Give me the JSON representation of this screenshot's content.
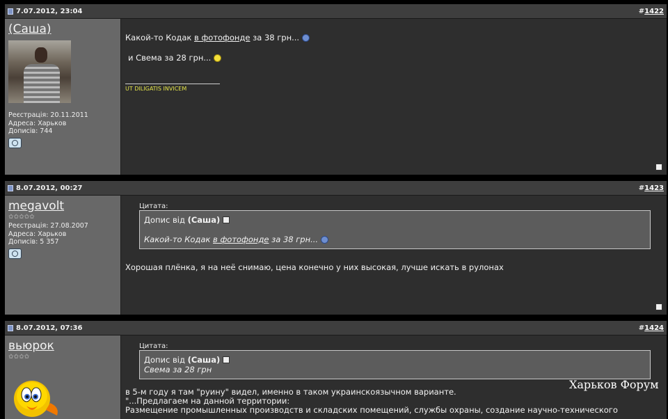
{
  "posts": [
    {
      "date": "7.07.2012, 23:04",
      "number_prefix": "#",
      "number": "1422",
      "username": "(Саша)",
      "stars": "",
      "registration": "Реєстрація: 20.11.2011",
      "address": "Адреса: Харьков",
      "posts_count": "Дописів: 744",
      "message": {
        "line1_before": "Какой-то Кодак ",
        "line1_link": "в фотофонде",
        "line1_after": " за 38 грн... ",
        "line2": "и Свема за 28 грн... ",
        "signature": "UT DILIGATIS INVICEM"
      }
    },
    {
      "date": "8.07.2012, 00:27",
      "number_prefix": "#",
      "number": "1423",
      "username": "megavolt",
      "stars": "✩✩✩✩✩",
      "registration": "Реєстрація: 27.08.2007",
      "address": "Адреса: Харьков",
      "posts_count": "Дописів: 5 357",
      "quote_label": "Цитата:",
      "quote_prefix": "Допис від ",
      "quote_author": "(Саша)",
      "quote_before": "Какой-то Кодак ",
      "quote_link": "в фотофонде",
      "quote_after": " за 38 грн... ",
      "message": "Хорошая плёнка, я на неё снимаю, цена конечно у них высокая, лучше искать в рулонах"
    },
    {
      "date": "8.07.2012, 07:36",
      "number_prefix": "#",
      "number": "1424",
      "username": "вьюрок",
      "stars": "✩✩✩✩",
      "quote_label": "Цитата:",
      "quote_prefix": "Допис від ",
      "quote_author": "(Саша)",
      "quote_text": "Свема за 28 грн",
      "message_line1": "в 5-м году я там \"руину\" видел, именно в таком украинскоязычном варианте.",
      "message_line2": "\"...Предлагаем на данной территории:",
      "message_line3": "Размещение промышленных производств и складских помещений, службы охраны, создание научно-технического"
    }
  ],
  "watermark": "Харьков Форум",
  "colors": {
    "header_bg": "#3e3e3e",
    "userinfo_bg": "#686868",
    "content_bg": "#2e2e2e",
    "signature": "#e6e64a"
  }
}
